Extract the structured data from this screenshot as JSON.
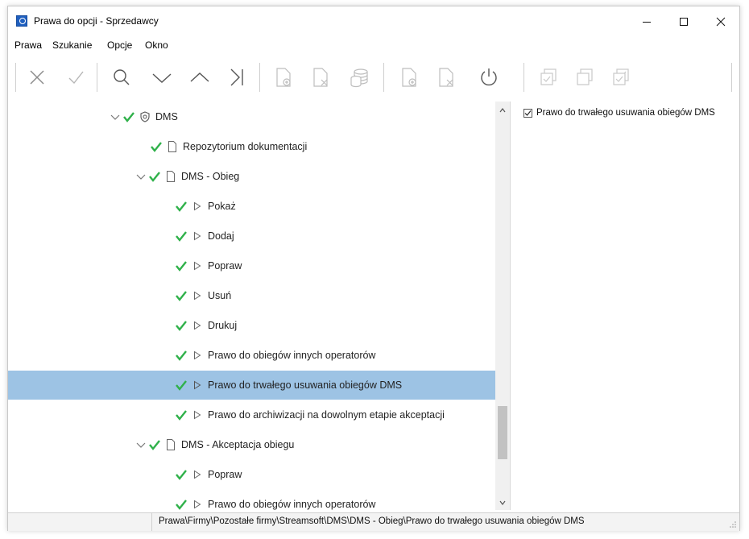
{
  "window": {
    "title": "Prawa do opcji - Sprzedawcy",
    "controls": [
      "minimize",
      "maximize",
      "close"
    ]
  },
  "menu": {
    "items": [
      "Prawa",
      "Szukanie",
      "Opcje",
      "Okno"
    ]
  },
  "toolbar": {
    "icons": [
      "cancel-icon",
      "accept-icon",
      "search-icon",
      "chevron-down-icon",
      "chevron-up-icon",
      "go-to-last-icon",
      "add-document-icon",
      "remove-document-icon",
      "database-icon",
      "add-document-icon",
      "remove-document-icon",
      "power-icon",
      "check-all-icon",
      "copy-icon",
      "check-copy-icon"
    ]
  },
  "tree": {
    "rows": [
      {
        "label": "DMS",
        "icon": "shield-icon",
        "expanded": true,
        "checked": true
      },
      {
        "label": "Repozytorium dokumentacji",
        "icon": "document-icon",
        "checked": true
      },
      {
        "label": "DMS - Obieg",
        "icon": "document-icon",
        "expanded": true,
        "checked": true
      },
      {
        "label": "Pokaż",
        "icon": "triangle-icon",
        "checked": true
      },
      {
        "label": "Dodaj",
        "icon": "triangle-icon",
        "checked": true
      },
      {
        "label": "Popraw",
        "icon": "triangle-icon",
        "checked": true
      },
      {
        "label": "Usuń",
        "icon": "triangle-icon",
        "checked": true
      },
      {
        "label": "Drukuj",
        "icon": "triangle-icon",
        "checked": true
      },
      {
        "label": "Prawo do obiegów innych operatorów",
        "icon": "triangle-icon",
        "checked": true
      },
      {
        "label": "Prawo do trwałego usuwania obiegów DMS",
        "icon": "triangle-icon",
        "checked": true,
        "selected": true
      },
      {
        "label": "Prawo do archiwizacji na dowolnym etapie akceptacji",
        "icon": "triangle-icon",
        "checked": true
      },
      {
        "label": "DMS - Akceptacja obiegu",
        "icon": "document-icon",
        "expanded": true,
        "checked": true
      },
      {
        "label": "Popraw",
        "icon": "triangle-icon",
        "checked": true
      },
      {
        "label": "Prawo do obiegów innych operatorów",
        "icon": "triangle-icon",
        "checked": true
      }
    ]
  },
  "right_pane": {
    "checkbox_label": "Prawo do trwałego usuwania obiegów DMS",
    "checked": true
  },
  "status": {
    "path": "Prawa\\Firmy\\Pozostałe firmy\\Streamsoft\\DMS\\DMS - Obieg\\Prawo do trwałego usuwania obiegów DMS"
  },
  "colors": {
    "selection": "#9dc3e4",
    "check": "#2fb14a",
    "app_icon": "#1f5fbf"
  }
}
